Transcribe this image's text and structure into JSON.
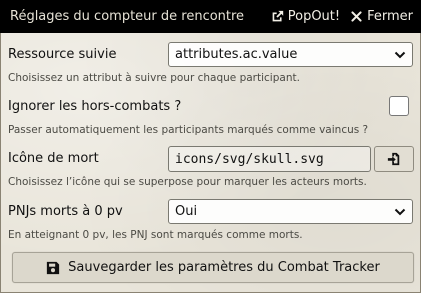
{
  "window": {
    "title": "Réglages du compteur de rencontre",
    "popout_label": "PopOut!",
    "close_label": "Fermer"
  },
  "fields": {
    "resource": {
      "label": "Ressource suivie",
      "value": "attributes.ac.value",
      "hint": "Choisissez un attribut à suivre pour chaque participant."
    },
    "skip_defeated": {
      "label": "Ignorer les hors-combats ?",
      "checked": false,
      "hint": "Passer automatiquement les participants marqués comme vaincus ?"
    },
    "death_icon": {
      "label": "Icône de mort",
      "value": "icons/svg/skull.svg",
      "hint": "Choisissez l’icône qui se superpose pour marquer les acteurs morts."
    },
    "npc_dead_at_zero": {
      "label": "PNJs morts à 0 pv",
      "value": "Oui",
      "hint": "En atteignant 0 pv, les PNJ sont marqués comme morts."
    }
  },
  "footer": {
    "save_label": "Sauvegarder les paramètres du Combat Tracker"
  },
  "icons": {
    "popout": "external-link-icon",
    "close": "close-icon",
    "chevron": "chevron-down-icon",
    "file_picker": "file-import-icon",
    "save": "save-icon"
  },
  "colors": {
    "header_bg": "#000000",
    "panel_bg": "#e9e5da",
    "hint_text": "#4b4a44"
  }
}
